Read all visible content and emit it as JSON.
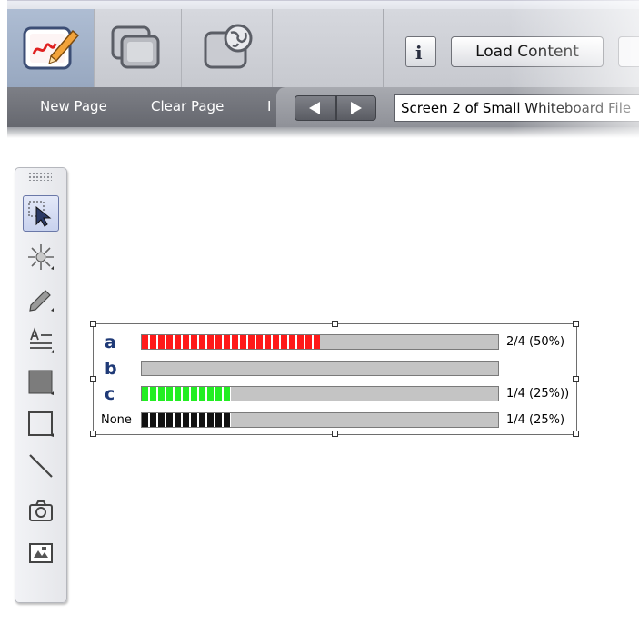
{
  "toolbar": {
    "modes": [
      {
        "name": "whiteboard",
        "icon": "whiteboard-pen-icon",
        "active": true
      },
      {
        "name": "share-screen",
        "icon": "overlapping-windows-icon",
        "active": false
      },
      {
        "name": "web",
        "icon": "globe-window-icon",
        "active": false
      }
    ],
    "info_label": "i",
    "load_content_label": "Load Content"
  },
  "page_bar": {
    "new_page_label": "New Page",
    "clear_page_label": "Clear Page",
    "truncated_label": "I",
    "screen_label": "Screen 2 of Small Whiteboard File"
  },
  "tools": [
    {
      "name": "select",
      "icon": "select-arrow-icon",
      "active": true
    },
    {
      "name": "laser-pointer",
      "icon": "laser-pointer-icon",
      "active": false
    },
    {
      "name": "pen",
      "icon": "pen-icon",
      "active": false
    },
    {
      "name": "text",
      "icon": "text-tool-icon",
      "active": false
    },
    {
      "name": "filled-rectangle",
      "icon": "filled-rectangle-icon",
      "active": false
    },
    {
      "name": "rectangle",
      "icon": "rectangle-icon",
      "active": false
    },
    {
      "name": "line",
      "icon": "line-icon",
      "active": false
    },
    {
      "name": "screenshot",
      "icon": "camera-icon",
      "active": false
    },
    {
      "name": "image",
      "icon": "image-icon",
      "active": false
    }
  ],
  "poll": {
    "rows": [
      {
        "label": "a",
        "fraction": 0.5,
        "color": "#ff1a1a",
        "value_text": "2/4 (50%)"
      },
      {
        "label": "b",
        "fraction": 0,
        "color": "#c4c4c4",
        "value_text": ""
      },
      {
        "label": "c",
        "fraction": 0.25,
        "color": "#22ee22",
        "value_text": "1/4 (25%))"
      },
      {
        "label": "None",
        "fraction": 0.25,
        "color": "#111111",
        "value_text": "1/4 (25%)"
      }
    ]
  },
  "colors": {
    "active_tool_border": "#6a78a8",
    "page_bar": "#6e7077",
    "title_label": "#1f3a77"
  }
}
